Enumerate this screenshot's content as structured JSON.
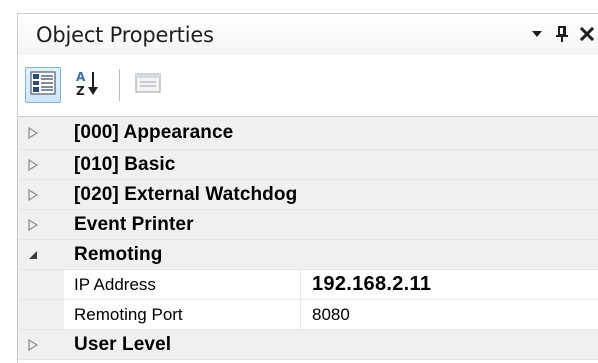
{
  "panel": {
    "title": "Object Properties",
    "title_buttons": [
      "dropdown-arrow-icon",
      "pin-icon",
      "close-icon"
    ]
  },
  "toolbar": {
    "buttons": [
      {
        "name": "categorized-view-button",
        "icon": "categorized-icon",
        "active": true
      },
      {
        "name": "alphabetical-sort-button",
        "icon": "sort-az-icon",
        "active": false
      },
      {
        "name": "property-pages-button",
        "icon": "property-pages-icon",
        "active": false,
        "disabled": true
      }
    ]
  },
  "grid": {
    "categories": [
      {
        "label": "[000] Appearance",
        "expanded": false
      },
      {
        "label": "[010] Basic",
        "expanded": false
      },
      {
        "label": "[020] External Watchdog",
        "expanded": false
      },
      {
        "label": "Event Printer",
        "expanded": false
      },
      {
        "label": "Remoting",
        "expanded": true,
        "properties": [
          {
            "name": "IP Address",
            "value": "192.168.2.11",
            "bold": true
          },
          {
            "name": "Remoting Port",
            "value": "8080",
            "bold": false
          }
        ]
      },
      {
        "label": "User Level",
        "expanded": false
      }
    ]
  },
  "colors": {
    "gutter": "#f0f0f0",
    "border": "#c9ccd1",
    "active_button": "#cfe5fa"
  }
}
